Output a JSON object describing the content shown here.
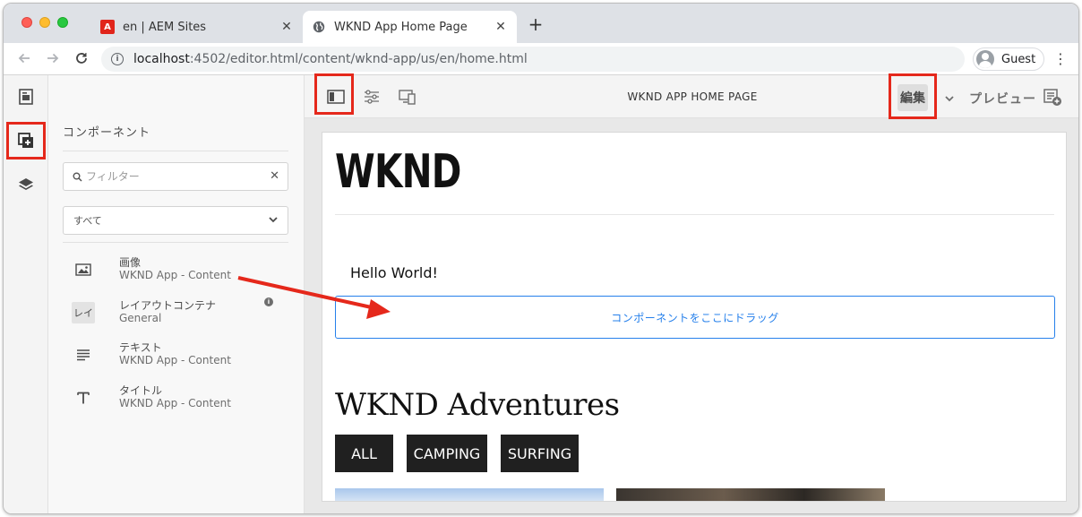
{
  "browser": {
    "tabs": [
      {
        "title": "en | AEM Sites",
        "favicon": "adobe-icon",
        "active": false
      },
      {
        "title": "WKND App Home Page",
        "favicon": "globe-icon",
        "active": true
      }
    ],
    "url_host": "localhost",
    "url_path": ":4502/editor.html/content/wknd-app/us/en/home.html",
    "profile_name": "Guest"
  },
  "rail": {
    "items": [
      {
        "icon": "page-info-icon"
      },
      {
        "icon": "components-icon",
        "highlighted": true
      },
      {
        "icon": "layers-icon"
      }
    ]
  },
  "panel": {
    "title": "コンポーネント",
    "filter_placeholder": "フィルター",
    "group_select": "すべて",
    "components": [
      {
        "name": "画像",
        "group": "WKND App - Content",
        "icon": "image-icon"
      },
      {
        "name": "レイアウトコンテナ",
        "group": "General",
        "icon": "layout-container-icon",
        "abbr": "レイ"
      },
      {
        "name": "テキスト",
        "group": "WKND App - Content",
        "icon": "text-icon"
      },
      {
        "name": "タイトル",
        "group": "WKND App - Content",
        "icon": "title-icon"
      }
    ]
  },
  "editor": {
    "page_title": "WKND APP HOME PAGE",
    "edit_label": "編集",
    "preview_label": "プレビュー"
  },
  "page": {
    "logo": "WKND",
    "hello": "Hello World!",
    "dropzone": "コンポーネントをここにドラッグ",
    "adventures_title": "WKND Adventures",
    "tags": [
      "ALL",
      "CAMPING",
      "SURFING"
    ]
  },
  "colors": {
    "highlight": "#e5281b",
    "dropzone": "#2680eb",
    "tag_bg": "#202020"
  }
}
